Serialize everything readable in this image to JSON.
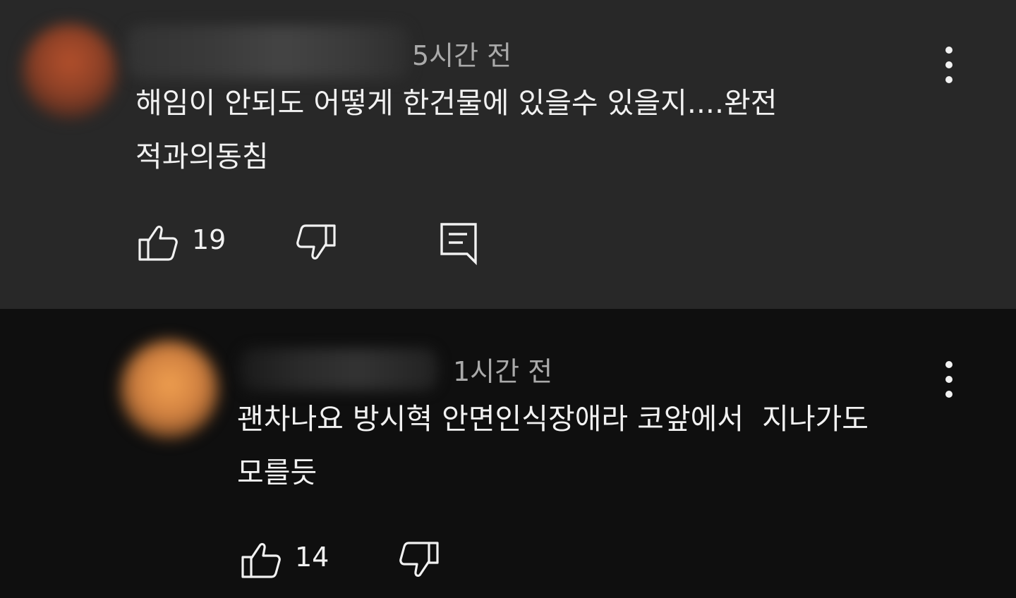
{
  "comments": [
    {
      "timestamp": "5시간 전",
      "text": "해임이 안되도 어떻게 한건물에 있을수 있을지....완전\n적과의동침",
      "like_count": "19",
      "has_reply_button": true
    },
    {
      "timestamp": "1시간 전",
      "text": "괜차나요 방시혁 안면인식장애라 코앞에서  지나가도\n모를듯",
      "like_count": "14",
      "has_reply_button": false
    }
  ],
  "icons": {
    "like": "thumb-up-icon",
    "dislike": "thumb-down-icon",
    "reply": "comment-reply-icon",
    "more": "more-vertical-icon"
  },
  "colors": {
    "top_comment_background": "#282828",
    "bottom_comment_background": "#0f0f0f",
    "primary_text": "#f1f1f1",
    "secondary_text": "#aaaaaa"
  }
}
